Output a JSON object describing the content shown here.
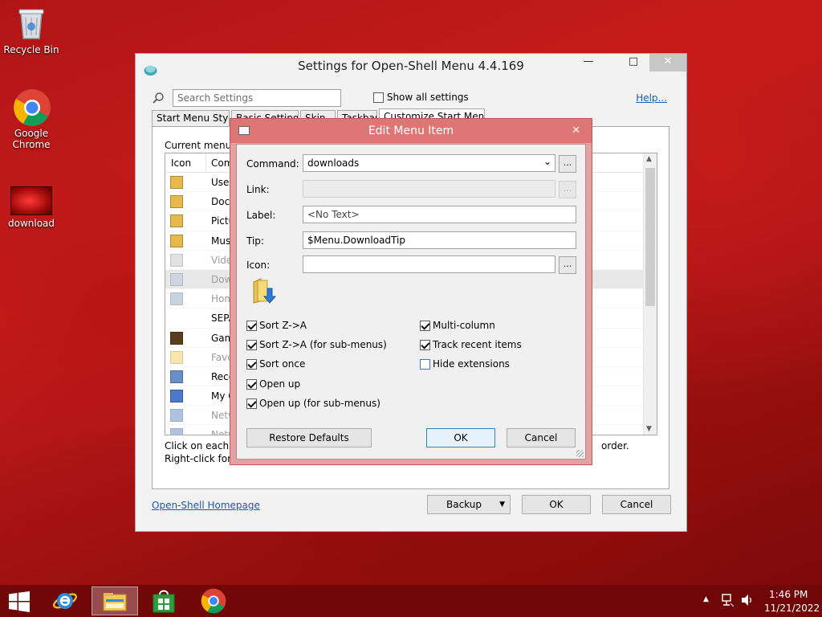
{
  "desktop": {
    "icons": [
      {
        "label": "Recycle Bin",
        "icon": "recycle-bin-icon"
      },
      {
        "label": "Google Chrome",
        "icon": "chrome-icon"
      },
      {
        "label": "download",
        "icon": "image-file-icon"
      }
    ]
  },
  "main_window": {
    "title": "Settings for Open-Shell Menu 4.4.169",
    "search_placeholder": "Search Settings",
    "show_all_label": "Show all settings",
    "help_link": "Help...",
    "tabs": [
      "Start Menu Style",
      "Basic Settings",
      "Skin",
      "Taskbar",
      "Customize Start Menu"
    ],
    "current_menu_label": "Current menu it",
    "columns": {
      "icon": "Icon",
      "command": "Com"
    },
    "rows": [
      "User",
      "Docu",
      "Pictu",
      "Musi",
      "Vide",
      "Dow",
      "Hom",
      "SEPA",
      "Gam",
      "Favo",
      "Rece",
      "My C",
      "Netw",
      "Netw"
    ],
    "hint_line1": "Click on each it",
    "hint_line1_end": "order.",
    "hint_line2": "Right-click for m",
    "homepage_link": "Open-Shell Homepage",
    "backup_button": "Backup",
    "ok_button": "OK",
    "cancel_button": "Cancel"
  },
  "dialog": {
    "title": "Edit Menu Item",
    "command_label": "Command:",
    "command_value": "downloads",
    "link_label": "Link:",
    "link_value": "",
    "label_label": "Label:",
    "label_value": "<No Text>",
    "tip_label": "Tip:",
    "tip_value": "$Menu.DownloadTip",
    "icon_label": "Icon:",
    "icon_value": "",
    "browse_label": "...",
    "checkboxes_left": [
      {
        "label": "Sort Z->A",
        "checked": true
      },
      {
        "label": "Sort Z->A (for sub-menus)",
        "checked": true
      },
      {
        "label": "Sort once",
        "checked": true
      },
      {
        "label": "Open up",
        "checked": true
      },
      {
        "label": "Open up (for sub-menus)",
        "checked": true
      }
    ],
    "checkboxes_right": [
      {
        "label": "Multi-column",
        "checked": true
      },
      {
        "label": "Track recent items",
        "checked": true
      },
      {
        "label": "Hide extensions",
        "checked": false
      }
    ],
    "restore_defaults": "Restore Defaults",
    "ok": "OK",
    "cancel": "Cancel"
  },
  "taskbar": {
    "time": "1:46 PM",
    "date": "11/21/2022",
    "pinned": [
      "start-icon",
      "internet-explorer-icon",
      "file-explorer-icon",
      "store-icon",
      "chrome-icon"
    ]
  }
}
